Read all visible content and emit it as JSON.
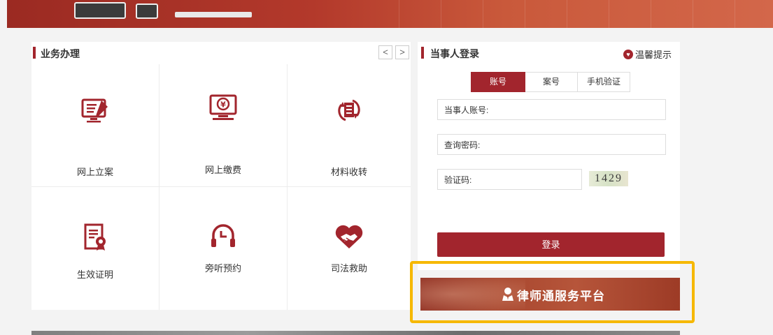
{
  "business": {
    "title": "业务办理",
    "prev_icon": "chevron-left-icon",
    "next_icon": "chevron-right-icon",
    "tiles": [
      {
        "label": "网上立案",
        "icon": "online-filing-icon"
      },
      {
        "label": "网上缴费",
        "icon": "online-payment-icon"
      },
      {
        "label": "材料收转",
        "icon": "material-transfer-icon"
      },
      {
        "label": "生效证明",
        "icon": "effective-certificate-icon"
      },
      {
        "label": "旁听预约",
        "icon": "hearing-appointment-icon"
      },
      {
        "label": "司法救助",
        "icon": "judicial-aid-icon"
      }
    ]
  },
  "login": {
    "title": "当事人登录",
    "tip": "温馨提示",
    "tabs": [
      "账号",
      "案号",
      "手机验证"
    ],
    "active_tab": "账号",
    "account_label": "当事人账号:",
    "password_label": "查询密码:",
    "captcha_label": "验证码:",
    "captcha_text": "1429",
    "submit": "登录"
  },
  "lawyer_platform": {
    "label": "律师通服务平台"
  },
  "colors": {
    "brand": "#a2252d",
    "highlight": "#f6b800"
  }
}
